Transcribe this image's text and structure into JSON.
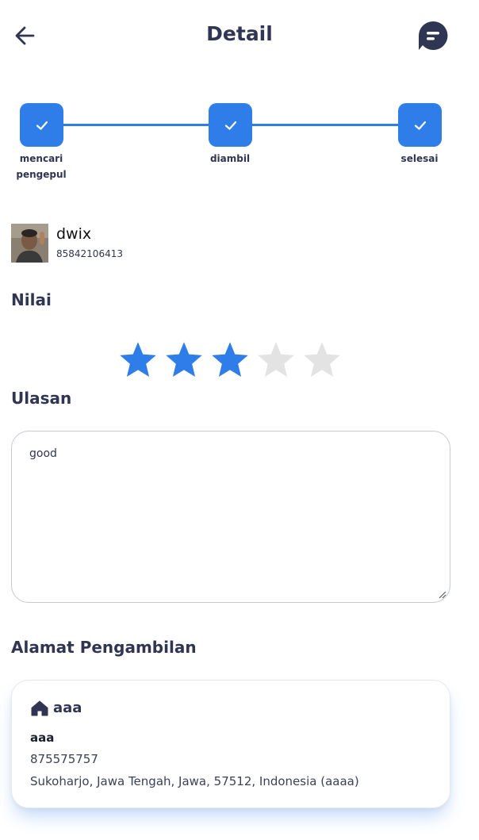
{
  "header": {
    "title": "Detail",
    "back_icon": "arrow-left-icon",
    "chat_icon": "chat-bubble-icon"
  },
  "stepper": {
    "accent": "#2f7de8",
    "steps": [
      {
        "label_line1": "mencari",
        "label_line2": "pengepul",
        "done": true
      },
      {
        "label_line1": "diambil",
        "label_line2": "",
        "done": true
      },
      {
        "label_line1": "selesai",
        "label_line2": "",
        "done": true
      }
    ]
  },
  "collector": {
    "name": "dwix",
    "phone": "85842106413"
  },
  "rating": {
    "title": "Nilai",
    "value": 3,
    "max": 5,
    "filled_color": "#2f7de8",
    "empty_color": "#e3e3e3"
  },
  "review": {
    "title": "Ulasan",
    "text": "good"
  },
  "pickup_address": {
    "title": "Alamat Pengambilan",
    "label": "aaa",
    "label_icon": "home-icon",
    "name": "aaa",
    "phone": "875575757",
    "address": "Sukoharjo, Jawa Tengah, Jawa, 57512, Indonesia (aaaa)"
  }
}
